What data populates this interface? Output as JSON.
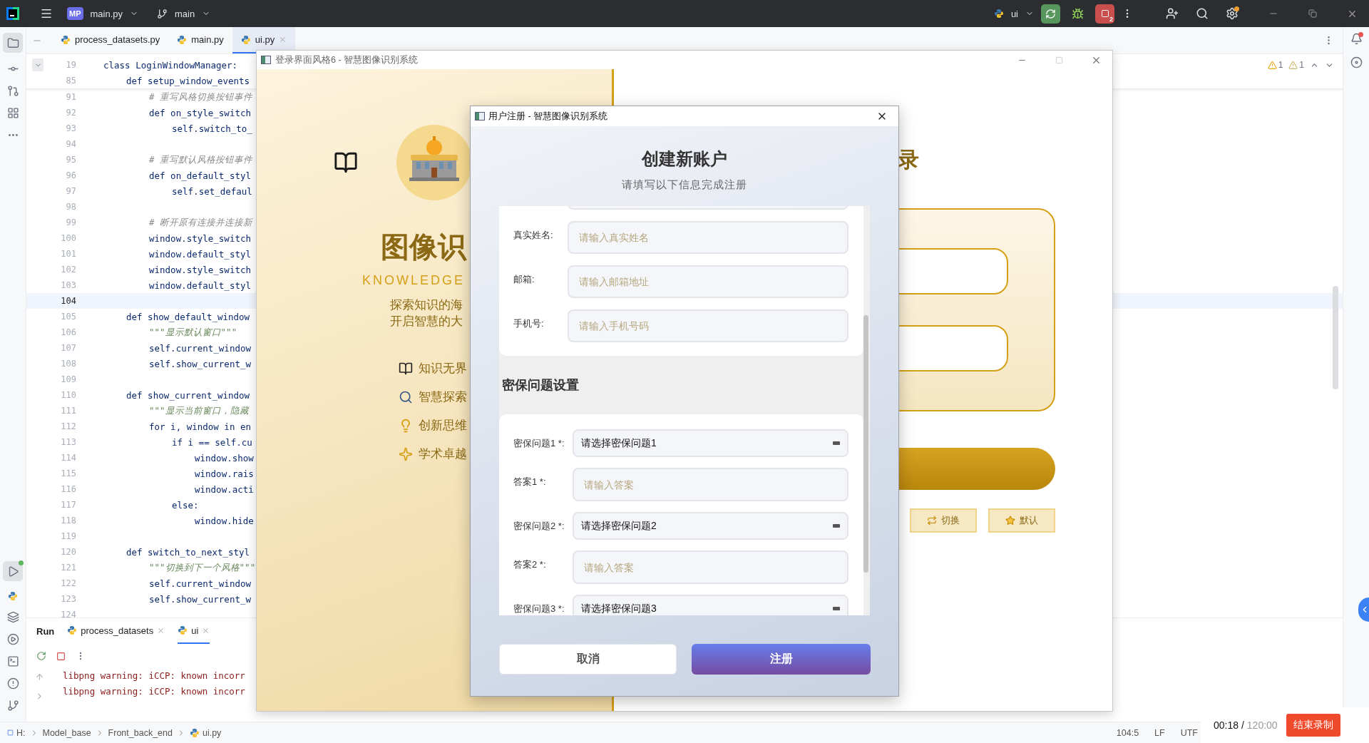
{
  "ide": {
    "top_bar": {
      "project_badge": "MP",
      "project": "main.py",
      "branch": "main",
      "run_config": "ui",
      "stop_badge": "2"
    },
    "file_tabs": [
      {
        "label": "process_datasets.py",
        "selected": false
      },
      {
        "label": "main.py",
        "selected": false
      },
      {
        "label": "ui.py",
        "selected": true
      }
    ],
    "editor": {
      "problems": [
        {
          "kind": "warning",
          "count": "1"
        },
        {
          "kind": "weak",
          "count": "1"
        }
      ],
      "lines": [
        {
          "number": "19",
          "kind": "code",
          "text": "class LoginWindowManager:",
          "current": false,
          "children": [
            {
              "number": "85",
              "kind": "code",
              "text": "def setup_window_events",
              "current": false,
              "children": [
                {
                  "number": "91",
                  "kind": "comment",
                  "text": "# 重写风格切换按钮事件",
                  "current": false
                },
                {
                  "number": "92",
                  "kind": "code",
                  "text": "def on_style_switch",
                  "current": false,
                  "children": [
                    {
                      "number": "93",
                      "kind": "code",
                      "text": "self.switch_to_",
                      "current": false
                    }
                  ]
                },
                {
                  "number": "94",
                  "current": false
                },
                {
                  "number": "95",
                  "kind": "comment",
                  "text": "# 重写默认风格按钮事件",
                  "current": false
                },
                {
                  "number": "96",
                  "kind": "code",
                  "text": "def on_default_styl",
                  "current": false,
                  "children": [
                    {
                      "number": "97",
                      "kind": "code",
                      "text": "self.set_defaul",
                      "current": false
                    }
                  ]
                },
                {
                  "number": "98",
                  "current": false
                },
                {
                  "number": "99",
                  "kind": "comment",
                  "text": "# 断开原有连接并连接新",
                  "current": false
                },
                {
                  "number": "100",
                  "kind": "code",
                  "text": "window.style_switch",
                  "current": false
                },
                {
                  "number": "101",
                  "kind": "code",
                  "text": "window.default_styl",
                  "current": false
                },
                {
                  "number": "102",
                  "kind": "code",
                  "text": "window.style_switch",
                  "current": false
                },
                {
                  "number": "103",
                  "kind": "code",
                  "text": "window.default_styl",
                  "current": false
                },
                {
                  "number": "104",
                  "current": true
                }
              ]
            },
            {
              "number": "105",
              "kind": "code",
              "text": "def show_default_window",
              "current": false,
              "children": [
                {
                  "number": "106",
                  "kind": "docstring",
                  "text": "\"\"\"显示默认窗口\"\"\"",
                  "current": false
                },
                {
                  "number": "107",
                  "kind": "code",
                  "text": "self.current_window",
                  "current": false
                },
                {
                  "number": "108",
                  "kind": "code",
                  "text": "self.show_current_w",
                  "current": false
                }
              ]
            },
            {
              "number": "109",
              "current": false
            },
            {
              "number": "110",
              "kind": "code",
              "text": "def show_current_window",
              "current": false,
              "children": [
                {
                  "number": "111",
                  "kind": "docstring",
                  "text": "\"\"\"显示当前窗口，隐藏",
                  "current": false
                },
                {
                  "number": "112",
                  "kind": "code",
                  "text": "for i, window in en",
                  "current": false,
                  "children": [
                    {
                      "number": "113",
                      "kind": "code",
                      "text": "if i == self.cu",
                      "current": false,
                      "children": [
                        {
                          "number": "114",
                          "kind": "code",
                          "text": "window.show",
                          "current": false
                        },
                        {
                          "number": "115",
                          "kind": "code",
                          "text": "window.rais",
                          "current": false
                        },
                        {
                          "number": "116",
                          "kind": "code",
                          "text": "window.acti",
                          "current": false
                        }
                      ]
                    },
                    {
                      "number": "117",
                      "kind": "code",
                      "text": "else:",
                      "current": false,
                      "children": [
                        {
                          "number": "118",
                          "kind": "code",
                          "text": "window.hide",
                          "current": false
                        }
                      ]
                    }
                  ]
                }
              ]
            },
            {
              "number": "119",
              "current": false
            },
            {
              "number": "120",
              "kind": "code",
              "text": "def switch_to_next_styl",
              "current": false,
              "children": [
                {
                  "number": "121",
                  "kind": "docstring",
                  "text": "\"\"\"切换到下一个风格\"\"\"",
                  "current": false
                },
                {
                  "number": "122",
                  "kind": "code",
                  "text": "self.current_window",
                  "current": false
                },
                {
                  "number": "123",
                  "kind": "code",
                  "text": "self.show_current_w",
                  "current": false
                }
              ]
            },
            {
              "number": "124",
              "current": false
            }
          ]
        }
      ]
    },
    "run_panel": {
      "title": "Run",
      "tabs": [
        {
          "label": "process_datasets",
          "selected": false
        },
        {
          "label": "ui",
          "selected": true
        }
      ],
      "output": [
        "libpng warning: iCCP: known incorr",
        "libpng warning: iCCP: known incorr"
      ]
    },
    "status_bar": {
      "path": [
        "H:",
        "Model_base",
        "Front_back_end",
        "ui.py"
      ],
      "position": "104:5",
      "line_separator": "LF",
      "encoding": "UTF"
    }
  },
  "login_window": {
    "title": "登录界面风格6 - 智慧图像识别系统",
    "brand_title": "图像识",
    "brand_subtitle": "KNOWLEDGE",
    "slogan": [
      "探索知识的海",
      "开启智慧的大"
    ],
    "features": [
      {
        "kind": "book",
        "label": "知识无界"
      },
      {
        "kind": "search",
        "label": "智慧探索"
      },
      {
        "kind": "bulb",
        "label": "创新思维"
      },
      {
        "kind": "sparkle",
        "label": "学术卓越"
      }
    ],
    "heading_fragment": "录",
    "buttons": [
      {
        "kind": "switch",
        "label": "切换"
      },
      {
        "kind": "star",
        "label": "默认"
      }
    ]
  },
  "register_dialog": {
    "title": "用户注册 - 智慧图像识别系统",
    "heading": "创建新账户",
    "subtitle": "请填写以下信息完成注册",
    "profile_fields": [
      {
        "label": "真实姓名:",
        "placeholder": "请输入真实姓名"
      },
      {
        "label": "邮箱:",
        "placeholder": "请输入邮箱地址"
      },
      {
        "label": "手机号:",
        "placeholder": "请输入手机号码"
      }
    ],
    "security_title": "密保问题设置",
    "security_fields": [
      {
        "kind": "select",
        "label": "密保问题1 *:",
        "value": "请选择密保问题1"
      },
      {
        "kind": "input",
        "label": "答案1 *:",
        "placeholder": "请输入答案"
      },
      {
        "kind": "select",
        "label": "密保问题2 *:",
        "value": "请选择密保问题2"
      },
      {
        "kind": "input",
        "label": "答案2 *:",
        "placeholder": "请输入答案"
      },
      {
        "kind": "select",
        "label": "密保问题3 *:",
        "value": "请选择密保问题3"
      }
    ],
    "cancel": "取消",
    "submit": "注册"
  },
  "recorder": {
    "elapsed": "00:18 /",
    "limit": "120:00",
    "stop_button": "结束录制"
  }
}
